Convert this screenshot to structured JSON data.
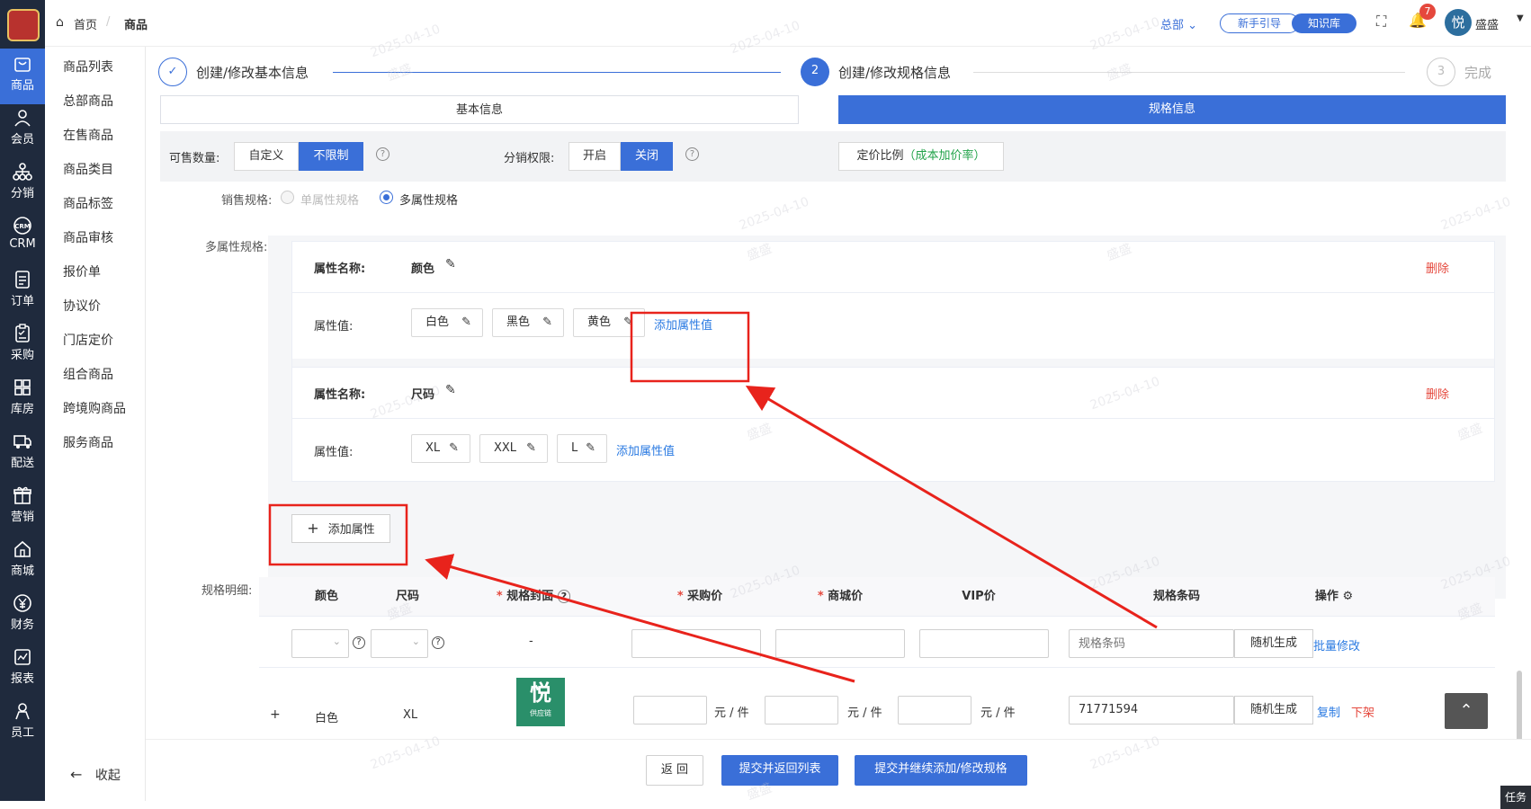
{
  "nav": {
    "rail": [
      {
        "label": "商品",
        "icon": "bag-icon"
      },
      {
        "label": "会员",
        "icon": "user-icon"
      },
      {
        "label": "分销",
        "icon": "hierarchy-icon"
      },
      {
        "label": "CRM",
        "icon": "crm-icon"
      },
      {
        "label": "订单",
        "icon": "order-icon"
      },
      {
        "label": "采购",
        "icon": "purchase-icon"
      },
      {
        "label": "库房",
        "icon": "warehouse-icon"
      },
      {
        "label": "配送",
        "icon": "truck-icon"
      },
      {
        "label": "营销",
        "icon": "gift-icon"
      },
      {
        "label": "商城",
        "icon": "store-icon"
      },
      {
        "label": "财务",
        "icon": "yen-icon"
      },
      {
        "label": "报表",
        "icon": "chart-icon"
      },
      {
        "label": "员工",
        "icon": "staff-icon"
      }
    ],
    "sub": [
      "商品列表",
      "总部商品",
      "在售商品",
      "商品类目",
      "商品标签",
      "商品审核",
      "报价单",
      "协议价",
      "门店定价",
      "组合商品",
      "跨境购商品",
      "服务商品"
    ],
    "collapse": "收起"
  },
  "topbar": {
    "breadcrumb_home": "首页",
    "breadcrumb_sep": "/",
    "breadcrumb_current": "商品",
    "store": "总部",
    "guide": "新手引导",
    "kb": "知识库",
    "notify_count": "7",
    "user": "盛盛",
    "avatar_text": "悦"
  },
  "steps": [
    {
      "num": "",
      "label": "创建/修改基本信息"
    },
    {
      "num": "2",
      "label": "创建/修改规格信息"
    },
    {
      "num": "3",
      "label": "完成"
    }
  ],
  "tabs": {
    "basic": "基本信息",
    "spec": "规格信息"
  },
  "form": {
    "qty_label": "可售数量:",
    "qty_custom": "自定义",
    "qty_unlimited": "不限制",
    "dist_label": "分销权限:",
    "dist_on": "开启",
    "dist_off": "关闭",
    "pricing": "定价比例",
    "pricing_hint": "（成本加价率）",
    "sale_spec_label": "销售规格:",
    "single": "单属性规格",
    "multi": "多属性规格",
    "multi_label": "多属性规格:"
  },
  "attrs": [
    {
      "name_label": "属性名称:",
      "name": "颜色",
      "value_label": "属性值:",
      "values": [
        "白色",
        "黑色",
        "黄色"
      ],
      "add": "添加属性值",
      "delete": "删除"
    },
    {
      "name_label": "属性名称:",
      "name": "尺码",
      "value_label": "属性值:",
      "values": [
        "XL",
        "XXL",
        "L"
      ],
      "add": "添加属性值",
      "delete": "删除"
    }
  ],
  "add_attr": "添加属性",
  "detail": {
    "label": "规格明细:",
    "headers": [
      "颜色",
      "尺码",
      "规格封面",
      "采购价",
      "商城价",
      "VIP价",
      "规格条码",
      "操作"
    ],
    "filter_dash": "-",
    "barcode_placeholder": "规格条码",
    "random": "随机生成",
    "batch": "批量修改",
    "row": {
      "plus": "+",
      "color": "白色",
      "size": "XL",
      "unit": "元 / 件",
      "barcode": "71771594",
      "copy": "复制",
      "down": "下架"
    },
    "thumb_char": "悦",
    "thumb_sub": "供应链"
  },
  "footer": {
    "back": "返 回",
    "submit_list": "提交并返回列表",
    "submit_continue": "提交并继续添加/修改规格"
  },
  "task": "任务",
  "watermark": {
    "date": "2025-04-10",
    "name": "盛盛"
  },
  "colors": {
    "primary": "#3a6fd8",
    "rail": "#1f2a3d",
    "annotation": "#e8231c",
    "danger": "#e5483d",
    "pricing_green": "#22a34a"
  }
}
